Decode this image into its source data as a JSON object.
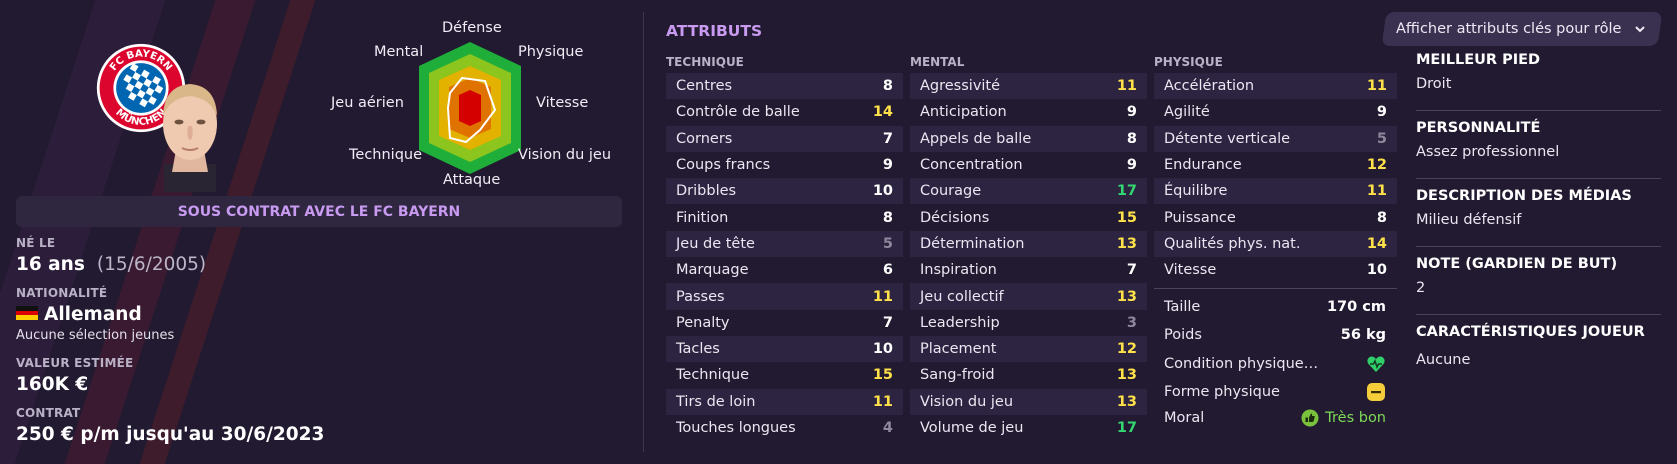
{
  "player": {
    "contract_banner": "SOUS CONTRAT AVEC LE FC BAYERN",
    "born_label": "NÉ LE",
    "age": "16 ans",
    "birth_date": "(15/6/2005)",
    "nationality_label": "NATIONALITÉ",
    "nationality": "Allemand",
    "caps": "Aucune sélection jeunes",
    "value_label": "VALEUR ESTIMÉE",
    "value": "160K €",
    "contract_label": "CONTRAT",
    "contract": "250 € p/m jusqu'au 30/6/2023"
  },
  "crest_text": "FC BAYERN MÜNCHEN",
  "radar": {
    "labels": {
      "defense": "Défense",
      "physique": "Physique",
      "vitesse": "Vitesse",
      "vision": "Vision du jeu",
      "attaque": "Attaque",
      "technique": "Technique",
      "jeu_aerien": "Jeu aérien",
      "mental": "Mental"
    },
    "colors": [
      "#1fae3a",
      "#8cc51d",
      "#e3b100",
      "#e07200",
      "#d40000"
    ]
  },
  "attributes": {
    "title": "ATTRIBUTS",
    "role_button": "Afficher attributs clés pour rôle",
    "role_button_icon": "chevron-down-icon",
    "technique": {
      "header": "TECHNIQUE",
      "rows": [
        {
          "name": "Centres",
          "value": "8"
        },
        {
          "name": "Contrôle de balle",
          "value": "14"
        },
        {
          "name": "Corners",
          "value": "7"
        },
        {
          "name": "Coups francs",
          "value": "9"
        },
        {
          "name": "Dribbles",
          "value": "10"
        },
        {
          "name": "Finition",
          "value": "8"
        },
        {
          "name": "Jeu de tête",
          "value": "5"
        },
        {
          "name": "Marquage",
          "value": "6"
        },
        {
          "name": "Passes",
          "value": "11"
        },
        {
          "name": "Penalty",
          "value": "7"
        },
        {
          "name": "Tacles",
          "value": "10"
        },
        {
          "name": "Technique",
          "value": "15"
        },
        {
          "name": "Tirs de loin",
          "value": "11"
        },
        {
          "name": "Touches longues",
          "value": "4"
        }
      ]
    },
    "mental": {
      "header": "MENTAL",
      "rows": [
        {
          "name": "Agressivité",
          "value": "11"
        },
        {
          "name": "Anticipation",
          "value": "9"
        },
        {
          "name": "Appels de balle",
          "value": "8"
        },
        {
          "name": "Concentration",
          "value": "9"
        },
        {
          "name": "Courage",
          "value": "17"
        },
        {
          "name": "Décisions",
          "value": "15"
        },
        {
          "name": "Détermination",
          "value": "13"
        },
        {
          "name": "Inspiration",
          "value": "7"
        },
        {
          "name": "Jeu collectif",
          "value": "13"
        },
        {
          "name": "Leadership",
          "value": "3"
        },
        {
          "name": "Placement",
          "value": "12"
        },
        {
          "name": "Sang-froid",
          "value": "13"
        },
        {
          "name": "Vision du jeu",
          "value": "13"
        },
        {
          "name": "Volume de jeu",
          "value": "17"
        }
      ]
    },
    "physique": {
      "header": "PHYSIQUE",
      "rows": [
        {
          "name": "Accélération",
          "value": "11"
        },
        {
          "name": "Agilité",
          "value": "9"
        },
        {
          "name": "Détente verticale",
          "value": "5"
        },
        {
          "name": "Endurance",
          "value": "12"
        },
        {
          "name": "Équilibre",
          "value": "11"
        },
        {
          "name": "Puissance",
          "value": "8"
        },
        {
          "name": "Qualités phys. nat.",
          "value": "14"
        },
        {
          "name": "Vitesse",
          "value": "10"
        }
      ]
    },
    "extras": {
      "height_label": "Taille",
      "height": "170 cm",
      "weight_label": "Poids",
      "weight": "56 kg",
      "condition_label": "Condition physique…",
      "condition_icon": "heart-icon",
      "form_label": "Forme physique",
      "form_icon": "neutral-face-icon",
      "morale_label": "Moral",
      "morale": "Très bon",
      "morale_icon": "thumbs-up-icon"
    }
  },
  "side": {
    "foot_label": "MEILLEUR PIED",
    "foot": "Droit",
    "personality_label": "PERSONNALITÉ",
    "personality": "Assez professionnel",
    "media_label": "DESCRIPTION DES MÉDIAS",
    "media": "Milieu défensif",
    "gk_label": "NOTE (GARDIEN DE BUT)",
    "gk": "2",
    "traits_label": "CARACTÉRISTIQUES JOUEUR",
    "traits": "Aucune"
  }
}
